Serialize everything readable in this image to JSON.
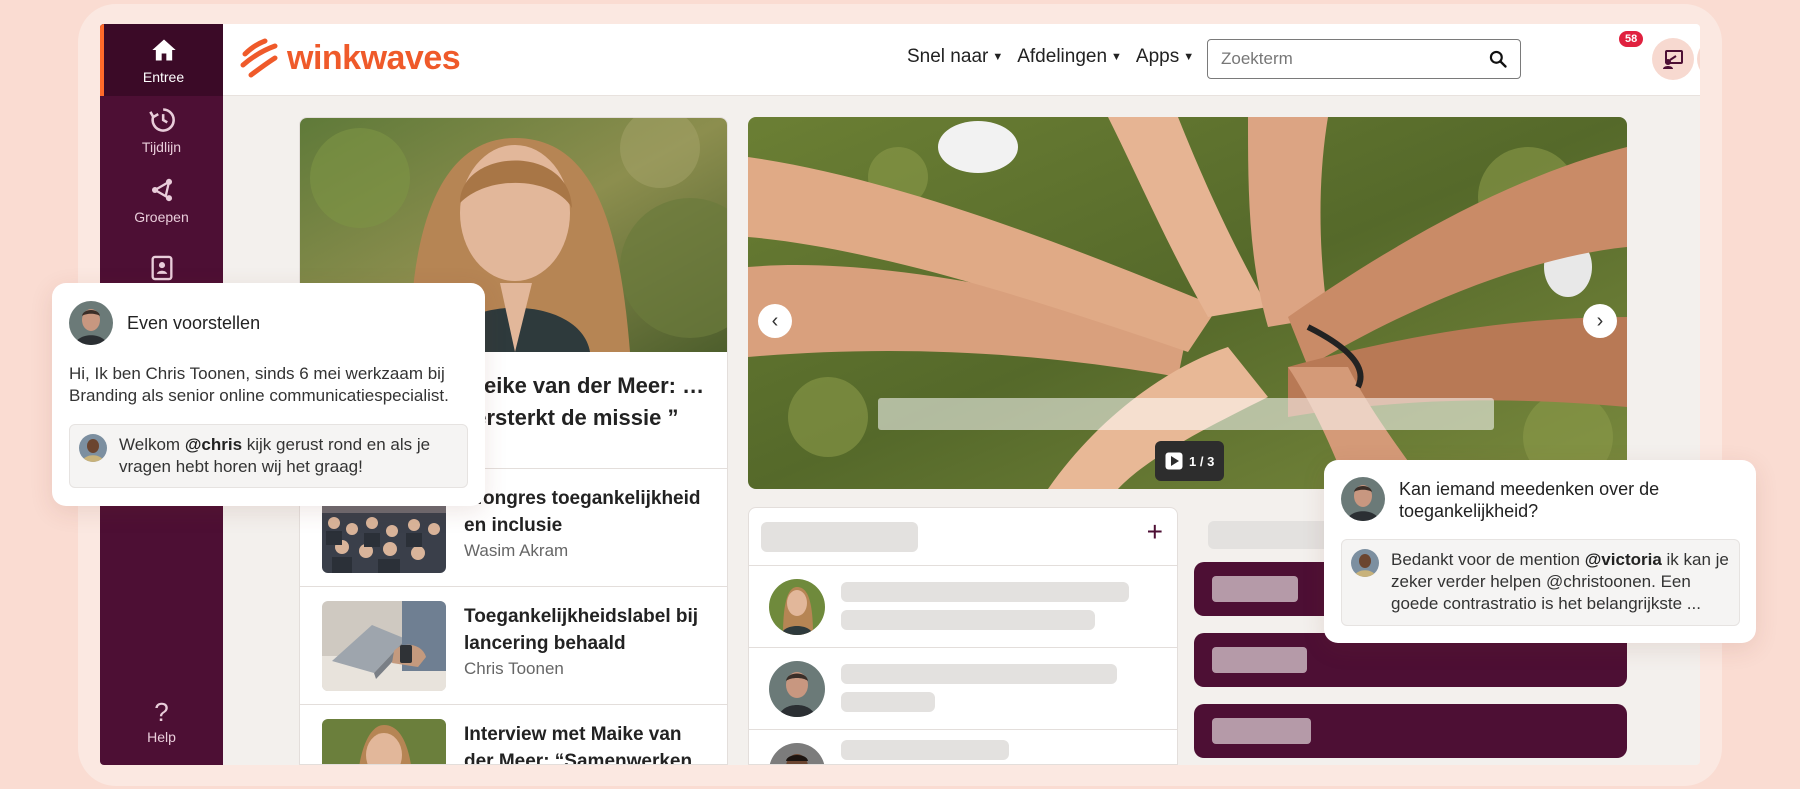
{
  "brand": {
    "name": "winkwaves",
    "accent": "#ef5a2a",
    "sidebar_color": "#4d0f34"
  },
  "sidebar": {
    "items": [
      {
        "label": "Entree",
        "icon": "home-icon"
      },
      {
        "label": "Tijdlijn",
        "icon": "history-icon"
      },
      {
        "label": "Groepen",
        "icon": "share-icon"
      },
      {
        "label": "",
        "icon": "contact-card-icon"
      }
    ],
    "help_label": "Help",
    "help_icon": "question-icon"
  },
  "header": {
    "menu": [
      {
        "label": "Snel naar"
      },
      {
        "label": "Afdelingen"
      },
      {
        "label": "Apps"
      }
    ],
    "search_placeholder": "Zoekterm",
    "notification_count": "58"
  },
  "news": {
    "headline": "…eike van der Meer: …versterkt de missie ”",
    "items": [
      {
        "title": "…ongres toegankelijkheid en inclusie",
        "author": "Wasim Akram"
      },
      {
        "title": "Toegankelijkheidslabel bij lancering behaald",
        "author": "Chris Toonen"
      },
      {
        "title": "Interview met Maike van der Meer: “Samenwerken",
        "author": ""
      }
    ]
  },
  "carousel": {
    "counter": "1 / 3",
    "prev_icon": "chevron-left-icon",
    "next_icon": "chevron-right-icon"
  },
  "groups": {
    "add_label": "+"
  },
  "card_intro": {
    "title": "Even voorstellen",
    "body": "Hi, Ik ben Chris Toonen, sinds 6 mei werkzaam bij Branding als senior online communicatiespecialist.",
    "reply_prefix": "Welkom ",
    "reply_mention": "@chris",
    "reply_suffix": " kijk gerust rond en als je vragen hebt horen wij het graag!"
  },
  "card_question": {
    "title": "Kan iemand meedenken over de toegankelijkheid?",
    "reply_prefix": "Bedankt voor de mention ",
    "reply_mention": "@victoria",
    "reply_suffix": " ik kan je zeker verder helpen @christoonen. Een goede contrastratio is het belangrijkste ..."
  }
}
